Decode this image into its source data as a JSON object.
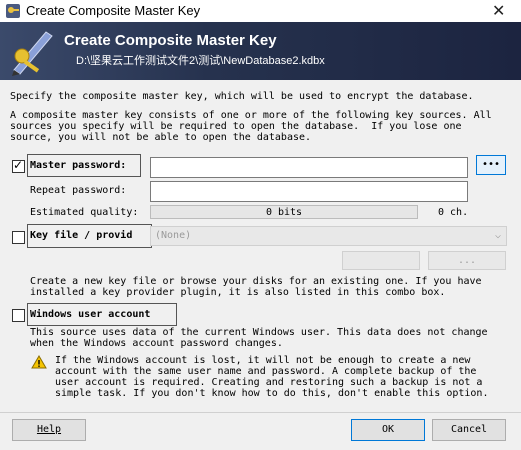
{
  "window": {
    "title": "Create Composite Master Key",
    "close_glyph": "✕"
  },
  "banner": {
    "title": "Create Composite Master Key",
    "path": "D:\\坚果云工作测试文件2\\测试\\NewDatabase2.kdbx"
  },
  "intro": {
    "line1": "Specify the composite master key, which will be used to encrypt the database.",
    "para2": "A composite master key consists of one or more of the following key sources. All\nsources you specify will be required to open the database.  If you lose one\nsource, you will not be able to open the database."
  },
  "master_password": {
    "label": "Master password:",
    "checked": true,
    "value": "",
    "show_button_label": "•••",
    "repeat_label": "Repeat password:",
    "repeat_value": "",
    "quality_label": "Estimated quality:",
    "quality_bits": "0 bits",
    "quality_chars": "0 ch.",
    "quality_fraction": 0
  },
  "key_file": {
    "label": "Key file / provid",
    "checked": false,
    "selected": "(None)",
    "description": "Create a new key file or browse your disks for an existing one. If you have\ninstalled a key provider plugin, it is also listed in this combo box.",
    "browse_label": "..."
  },
  "windows_account": {
    "label": "Windows user account",
    "checked": false,
    "description": "This source uses data of the current Windows user. This data does not change\nwhen the Windows account password changes.",
    "warning": "If the Windows account is lost, it will not be enough to create a new\naccount with the same user name and password. A complete backup of the\nuser account is required. Creating and restoring such a backup is not a\nsimple task. If you don't know how to do this, don't enable this option.",
    "warning_icon": "warning-icon"
  },
  "footer": {
    "help_label": "Help",
    "ok_label": "OK",
    "cancel_label": "Cancel"
  }
}
